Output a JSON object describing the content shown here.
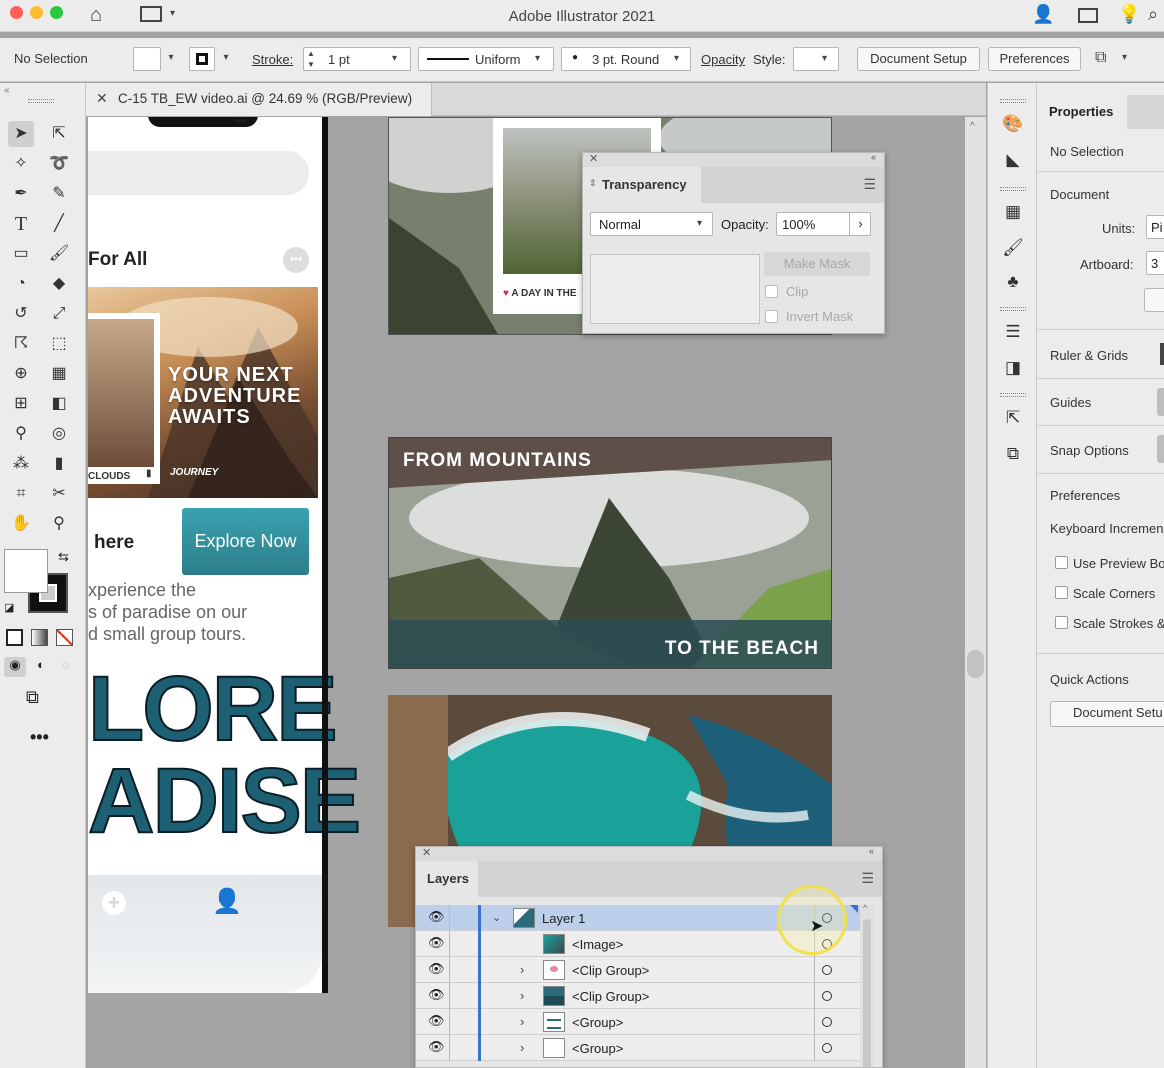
{
  "window": {
    "title": "Adobe Illustrator 2021",
    "traffic_colors": [
      "#fe5f57",
      "#febc2e",
      "#28c840"
    ]
  },
  "control_bar": {
    "selection": "No Selection",
    "stroke_label": "Stroke:",
    "stroke_value": "1 pt",
    "profile": "Uniform",
    "brush": "3 pt. Round",
    "opacity_label": "Opacity",
    "style_label": "Style:",
    "document_setup": "Document Setup",
    "preferences": "Preferences"
  },
  "document_tab": {
    "title": "C-15 TB_EW video.ai @ 24.69 % (RGB/Preview)"
  },
  "artboards": {
    "mobile": {
      "section_title": "For All",
      "hero_text": "YOUR NEXT ADVENTURE AWAITS",
      "hero_caption_left": "CLOUDS",
      "hero_caption_right": "JOURNEY",
      "cta_heading": "here",
      "cta_button": "Explore Now",
      "body_line1": "xperience the",
      "body_line2": "s of paradise on our",
      "body_line3": "d small group tours.",
      "big_word1": "LORE",
      "big_word2": "ADISE"
    },
    "top_card_caption": "A DAY IN THE",
    "banner": {
      "top_text": "FROM MOUNTAINS",
      "bottom_text": "TO THE BEACH"
    }
  },
  "transparency_panel": {
    "title": "Transparency",
    "blend_mode": "Normal",
    "opacity_label": "Opacity:",
    "opacity_value": "100%",
    "make_mask": "Make Mask",
    "clip": "Clip",
    "invert_mask": "Invert Mask"
  },
  "layers_panel": {
    "title": "Layers",
    "rows": [
      {
        "name": "Layer 1"
      },
      {
        "name": "<Image>"
      },
      {
        "name": "<Clip Group>"
      },
      {
        "name": "<Clip Group>"
      },
      {
        "name": "<Group>"
      },
      {
        "name": "<Group>"
      }
    ]
  },
  "properties_panel": {
    "tab": "Properties",
    "selection": "No Selection",
    "document": "Document",
    "units_label": "Units:",
    "units_value": "Pi",
    "artboard_label": "Artboard:",
    "artboard_value": "3",
    "ruler_grids": "Ruler & Grids",
    "guides": "Guides",
    "snap_options": "Snap Options",
    "preferences": "Preferences",
    "keyboard_increment": "Keyboard Incremen",
    "use_preview_bounds": "Use Preview Bo",
    "scale_corners": "Scale Corners",
    "scale_strokes": "Scale Strokes &",
    "quick_actions": "Quick Actions",
    "document_setup": "Document Setu"
  },
  "colors": {
    "accent_blue": "#3a73c9",
    "selection_row": "#bcd0ec",
    "teal_button": "#3497a6"
  }
}
